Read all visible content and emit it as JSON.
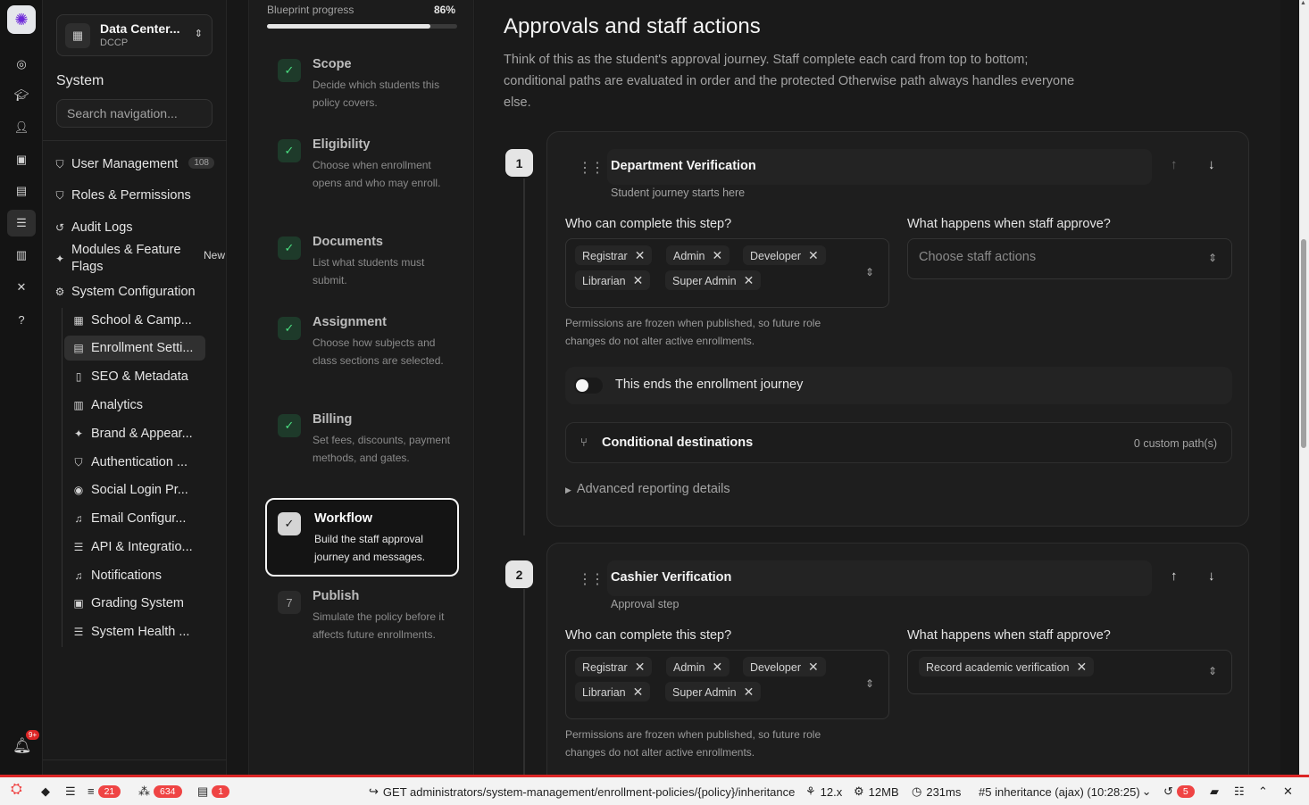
{
  "rail": {
    "icons": [
      "app-logo-icon",
      "compass-icon",
      "graduation-cap-icon",
      "user-icon",
      "ticket-icon",
      "briefcase-icon",
      "database-icon",
      "library-icon",
      "tools-icon",
      "help-icon"
    ],
    "notification_count": "9+"
  },
  "org": {
    "name": "Data Center...",
    "code": "DCCP"
  },
  "nav": {
    "section_title": "System",
    "search_placeholder": "Search navigation...",
    "items": [
      {
        "label": "User Management",
        "count": "108",
        "icon": "shield-icon"
      },
      {
        "label": "Roles & Permissions",
        "icon": "shield-icon"
      },
      {
        "label": "Audit Logs",
        "icon": "history-icon"
      },
      {
        "label": "Modules & Feature Flags",
        "badge": "New",
        "icon": "sparkle-icon"
      },
      {
        "label": "System Configuration",
        "icon": "gear-icon"
      }
    ],
    "sub_items": [
      {
        "label": "School & Camp...",
        "icon": "building-icon"
      },
      {
        "label": "Enrollment Setti...",
        "icon": "document-icon",
        "active": true
      },
      {
        "label": "SEO & Metadata",
        "icon": "file-icon"
      },
      {
        "label": "Analytics",
        "icon": "chart-icon"
      },
      {
        "label": "Brand & Appear...",
        "icon": "sparkle-icon"
      },
      {
        "label": "Authentication ...",
        "icon": "shield-icon"
      },
      {
        "label": "Social Login Pr...",
        "icon": "user-circle-icon"
      },
      {
        "label": "Email Configur...",
        "icon": "bell-icon"
      },
      {
        "label": "API & Integratio...",
        "icon": "server-icon"
      },
      {
        "label": "Notifications",
        "icon": "bell-icon"
      },
      {
        "label": "Grading System",
        "icon": "clipboard-icon"
      },
      {
        "label": "System Health ...",
        "icon": "server-icon"
      }
    ]
  },
  "blueprint": {
    "progress_label": "Blueprint progress",
    "progress_value": "86%",
    "progress_fraction": 0.86,
    "steps": [
      {
        "title": "Scope",
        "desc": "Decide which students this policy covers.",
        "done": true
      },
      {
        "title": "Eligibility",
        "desc": "Choose when enrollment opens and who may enroll.",
        "done": true
      },
      {
        "title": "Documents",
        "desc": "List what students must submit.",
        "done": true
      },
      {
        "title": "Assignment",
        "desc": "Choose how subjects and class sections are selected.",
        "done": true
      },
      {
        "title": "Billing",
        "desc": "Set fees, discounts, payment methods, and gates.",
        "done": true
      },
      {
        "title": "Workflow",
        "desc": "Build the staff approval journey and messages.",
        "done": true,
        "active": true
      },
      {
        "title": "Publish",
        "desc": "Simulate the policy before it affects future enrollments.",
        "number": "7"
      }
    ]
  },
  "main": {
    "title": "Approvals and staff actions",
    "description": "Think of this as the student's approval journey. Staff complete each card from top to bottom; conditional paths are evaluated in order and the protected Otherwise path always handles everyone else.",
    "cards": [
      {
        "number": "1",
        "title": "Department Verification",
        "subtitle": "Student journey starts here",
        "who_label": "Who can complete this step?",
        "roles": [
          "Registrar",
          "Admin",
          "Developer",
          "Librarian",
          "Super Admin"
        ],
        "approve_label": "What happens when staff approve?",
        "approve_placeholder": "Choose staff actions",
        "help": "Permissions are frozen when published, so future role changes do not alter active enrollments.",
        "toggle_label": "This ends the enrollment journey",
        "toggle_on": false,
        "cond_label": "Conditional destinations",
        "cond_count": "0 custom path(s)",
        "advanced_label": "Advanced reporting details"
      },
      {
        "number": "2",
        "title": "Cashier Verification",
        "subtitle": "Approval step",
        "who_label": "Who can complete this step?",
        "roles": [
          "Registrar",
          "Admin",
          "Developer",
          "Librarian",
          "Super Admin"
        ],
        "approve_label": "What happens when staff approve?",
        "approve_value": "Record academic verification",
        "help": "Permissions are frozen when published, so future role changes do not alter active enrollments."
      }
    ]
  },
  "debugbar": {
    "messages_count": "21",
    "models_count": "634",
    "views_count": "1",
    "request": "GET administrators/system-management/enrollment-policies/{policy}/inheritance",
    "version": "12.x",
    "memory": "12MB",
    "time": "231ms",
    "request_label": "#5 inheritance (ajax) (10:28:25)",
    "history_count": "5"
  },
  "colors": {
    "accent_green": "#4ade80",
    "debug_red": "#ef4444",
    "bg": "#171717"
  }
}
